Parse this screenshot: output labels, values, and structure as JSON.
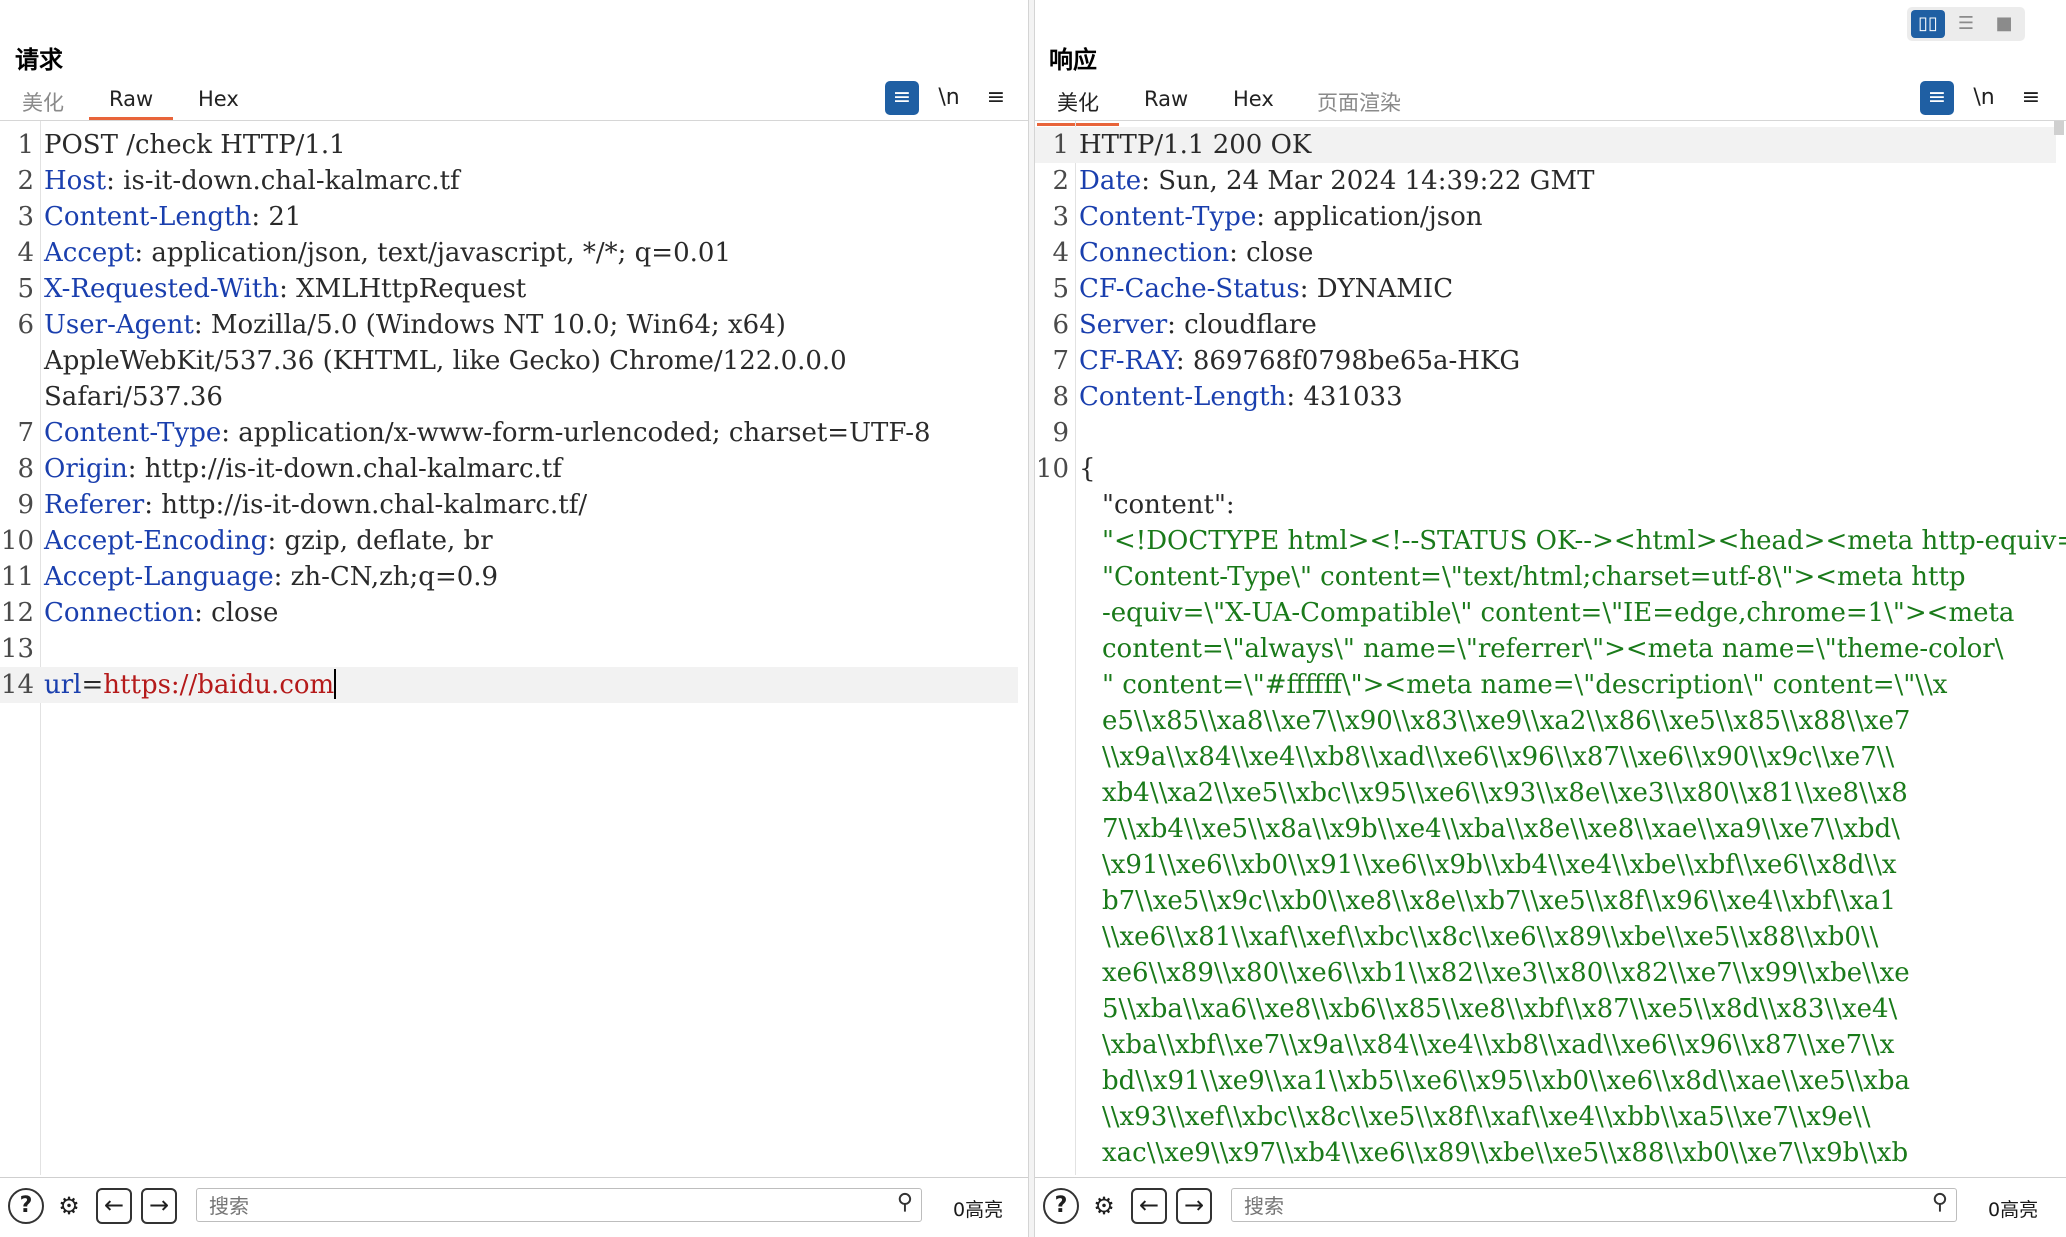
{
  "request": {
    "title": "请求",
    "tabs": [
      "美化",
      "Raw",
      "Hex"
    ],
    "tools": {
      "wrap": "≡",
      "newline": "\\n",
      "menu": "≡"
    },
    "lines": [
      {
        "n": "1",
        "k": "",
        "v": "POST /check HTTP/1.1"
      },
      {
        "n": "2",
        "k": "Host",
        "v": ": is-it-down.chal-kalmarc.tf"
      },
      {
        "n": "3",
        "k": "Content-Length",
        "v": ": 21"
      },
      {
        "n": "4",
        "k": "Accept",
        "v": ": application/json, text/javascript, */*; q=0.01"
      },
      {
        "n": "5",
        "k": "X-Requested-With",
        "v": ": XMLHttpRequest"
      },
      {
        "n": "6",
        "k": "User-Agent",
        "v": ": Mozilla/5.0 (Windows NT 10.0; Win64; x64)"
      },
      {
        "n": "",
        "k": "",
        "v": "AppleWebKit/537.36 (KHTML, like Gecko) Chrome/122.0.0.0"
      },
      {
        "n": "",
        "k": "",
        "v": "Safari/537.36"
      },
      {
        "n": "7",
        "k": "Content-Type",
        "v": ": application/x-www-form-urlencoded; charset=UTF-8"
      },
      {
        "n": "8",
        "k": "Origin",
        "v": ": http://is-it-down.chal-kalmarc.tf"
      },
      {
        "n": "9",
        "k": "Referer",
        "v": ": http://is-it-down.chal-kalmarc.tf/"
      },
      {
        "n": "10",
        "k": "Accept-Encoding",
        "v": ": gzip, deflate, br"
      },
      {
        "n": "11",
        "k": "Accept-Language",
        "v": ": zh-CN,zh;q=0.9"
      },
      {
        "n": "12",
        "k": "Connection",
        "v": ": close"
      },
      {
        "n": "13",
        "k": "",
        "v": ""
      }
    ],
    "body_line": {
      "n": "14",
      "k": "url",
      "eq": "=",
      "v": "https://baidu.com"
    },
    "search_placeholder": "搜索",
    "highlight_count": "0高亮"
  },
  "response": {
    "title": "响应",
    "tabs": [
      "美化",
      "Raw",
      "Hex",
      "页面渲染"
    ],
    "tools": {
      "wrap": "≡",
      "newline": "\\n",
      "menu": "≡"
    },
    "lines": [
      {
        "n": "1",
        "k": "",
        "v": "HTTP/1.1 200 OK"
      },
      {
        "n": "2",
        "k": "Date",
        "v": ": Sun, 24 Mar 2024 14:39:22 GMT"
      },
      {
        "n": "3",
        "k": "Content-Type",
        "v": ": application/json"
      },
      {
        "n": "4",
        "k": "Connection",
        "v": ": close"
      },
      {
        "n": "5",
        "k": "CF-Cache-Status",
        "v": ": DYNAMIC"
      },
      {
        "n": "6",
        "k": "Server",
        "v": ": cloudflare"
      },
      {
        "n": "7",
        "k": "CF-RAY",
        "v": ": 869768f0798be65a-HKG"
      },
      {
        "n": "8",
        "k": "Content-Length",
        "v": ": 431033"
      },
      {
        "n": "9",
        "k": "",
        "v": ""
      },
      {
        "n": "10",
        "k": "",
        "v": "{"
      }
    ],
    "json_key": "\"content\":",
    "json_lines": [
      "\"<!DOCTYPE html><!--STATUS OK--><html><head><meta http-equiv=\\",
      "\"Content-Type\\\" content=\\\"text/html;charset=utf-8\\\"><meta http",
      "-equiv=\\\"X-UA-Compatible\\\" content=\\\"IE=edge,chrome=1\\\"><meta",
      "content=\\\"always\\\" name=\\\"referrer\\\"><meta name=\\\"theme-color\\",
      "\" content=\\\"#ffffff\\\"><meta name=\\\"description\\\" content=\\\"\\\\x",
      "e5\\\\x85\\\\xa8\\\\xe7\\\\x90\\\\x83\\\\xe9\\\\xa2\\\\x86\\\\xe5\\\\x85\\\\x88\\\\xe7",
      "\\\\x9a\\\\x84\\\\xe4\\\\xb8\\\\xad\\\\xe6\\\\x96\\\\x87\\\\xe6\\\\x90\\\\x9c\\\\xe7\\\\",
      "xb4\\\\xa2\\\\xe5\\\\xbc\\\\x95\\\\xe6\\\\x93\\\\x8e\\\\xe3\\\\x80\\\\x81\\\\xe8\\\\x8",
      "7\\\\xb4\\\\xe5\\\\x8a\\\\x9b\\\\xe4\\\\xba\\\\x8e\\\\xe8\\\\xae\\\\xa9\\\\xe7\\\\xbd\\",
      "\\x91\\\\xe6\\\\xb0\\\\x91\\\\xe6\\\\x9b\\\\xb4\\\\xe4\\\\xbe\\\\xbf\\\\xe6\\\\x8d\\\\x",
      "b7\\\\xe5\\\\x9c\\\\xb0\\\\xe8\\\\x8e\\\\xb7\\\\xe5\\\\x8f\\\\x96\\\\xe4\\\\xbf\\\\xa1",
      "\\\\xe6\\\\x81\\\\xaf\\\\xef\\\\xbc\\\\x8c\\\\xe6\\\\x89\\\\xbe\\\\xe5\\\\x88\\\\xb0\\\\",
      "xe6\\\\x89\\\\x80\\\\xe6\\\\xb1\\\\x82\\\\xe3\\\\x80\\\\x82\\\\xe7\\\\x99\\\\xbe\\\\xe",
      "5\\\\xba\\\\xa6\\\\xe8\\\\xb6\\\\x85\\\\xe8\\\\xbf\\\\x87\\\\xe5\\\\x8d\\\\x83\\\\xe4\\",
      "\\xba\\\\xbf\\\\xe7\\\\x9a\\\\x84\\\\xe4\\\\xb8\\\\xad\\\\xe6\\\\x96\\\\x87\\\\xe7\\\\x",
      "bd\\\\x91\\\\xe9\\\\xa1\\\\xb5\\\\xe6\\\\x95\\\\xb0\\\\xe6\\\\x8d\\\\xae\\\\xe5\\\\xba",
      "\\\\x93\\\\xef\\\\xbc\\\\x8c\\\\xe5\\\\x8f\\\\xaf\\\\xe4\\\\xbb\\\\xa5\\\\xe7\\\\x9e\\\\",
      "xac\\\\xe9\\\\x97\\\\xb4\\\\xe6\\\\x89\\\\xbe\\\\xe5\\\\x88\\\\xb0\\\\xe7\\\\x9b\\\\xb"
    ],
    "search_placeholder": "搜索",
    "highlight_count": "0高亮"
  },
  "colors": {
    "accent": "#1f5fa3",
    "tab_underline": "#e8643a",
    "header_key": "#1a3fae",
    "json_string": "#1a7a1a",
    "param_value": "#b51a1a"
  },
  "icons": [
    "help-icon",
    "settings-icon",
    "back-arrow-icon",
    "forward-arrow-icon",
    "search-icon",
    "wrap-icon",
    "newline-icon",
    "menu-icon",
    "layout-split-icon"
  ]
}
